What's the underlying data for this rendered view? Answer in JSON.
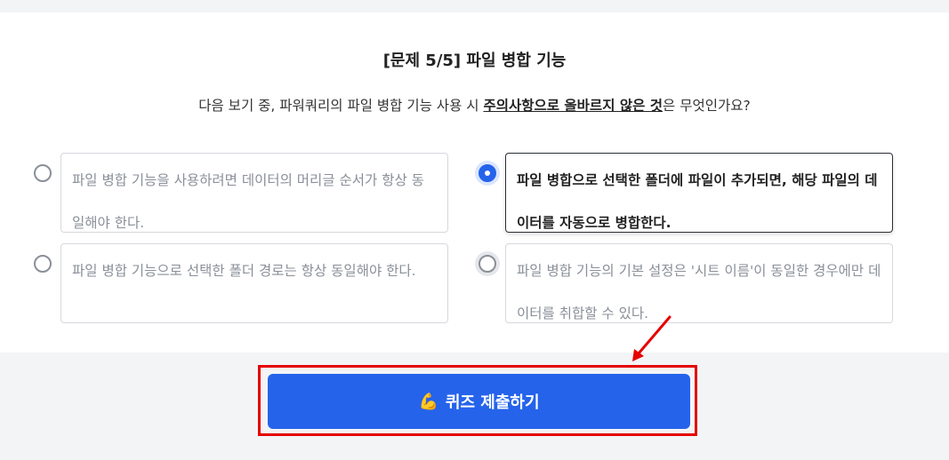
{
  "question": {
    "title": "[문제 5/5] 파일 병합 기능",
    "text_before": "다음 보기 중, 파워쿼리의 파일 병합 기능 사용 시 ",
    "text_emphasis": "주의사항으로 올바르지 않은 것",
    "text_after": "은 무엇인가요?"
  },
  "options": [
    {
      "label": "파일 병합 기능을 사용하려면 데이터의 머리글 순서가 항상 동일해야 한다.",
      "selected": false
    },
    {
      "label": "파일 병합으로 선택한 폴더에 파일이 추가되면, 해당 파일의 데이터를 자동으로 병합한다.",
      "selected": true
    },
    {
      "label": "파일 병합 기능으로 선택한 폴더 경로는 항상 동일해야 한다.",
      "selected": false
    },
    {
      "label": "파일 병합 기능의 기본 설정은 '시트 이름'이 동일한 경우에만 데이터를 취합할 수 있다.",
      "selected": false
    }
  ],
  "submit": {
    "icon": "flexed-biceps-icon",
    "emoji": "💪",
    "label": "퀴즈 제출하기"
  },
  "colors": {
    "accent": "#2563eb",
    "highlight": "#e60000"
  }
}
